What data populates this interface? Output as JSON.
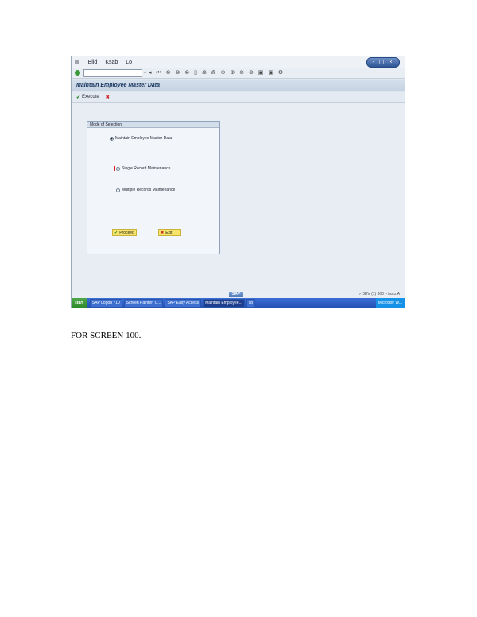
{
  "screenshot": {
    "menu": [
      "Bild",
      "Ksab",
      "Lo"
    ],
    "window_controls": "- ▢ ×",
    "toolbar_icons": "◂ ⏮ ⊗ ⊗ ⊗ ▯ ⋒ ⋒ ⊕ ⊕ ⊕ ⊕ ▣ ▣ ⚙",
    "title": "Maintain Employee Master Data",
    "app_toolbar": {
      "execute_label": "Execute"
    },
    "frame": {
      "title": "Mode of Selection",
      "options": [
        {
          "label": "Maintain Employee Master Data",
          "selected": true
        },
        {
          "label": "Single Record Maintenance",
          "selected": false,
          "focused": true
        },
        {
          "label": "Multiple Records Maintenance",
          "selected": false
        }
      ],
      "ok_button": "Proceed",
      "cancel_button": "Exit"
    },
    "status": {
      "logo": "SAP",
      "text": "▹ DEV (1) 800 ▾ ins  ▵ A"
    },
    "taskbar": {
      "start": "start",
      "items": [
        "SAP Logon 710",
        "Screen Painter: C...",
        "SAP Easy Access",
        "Maintain Employee...",
        "sb"
      ],
      "active_index": 3,
      "tray": "Microsoft W..."
    }
  },
  "caption": "FOR SCREEN 100."
}
